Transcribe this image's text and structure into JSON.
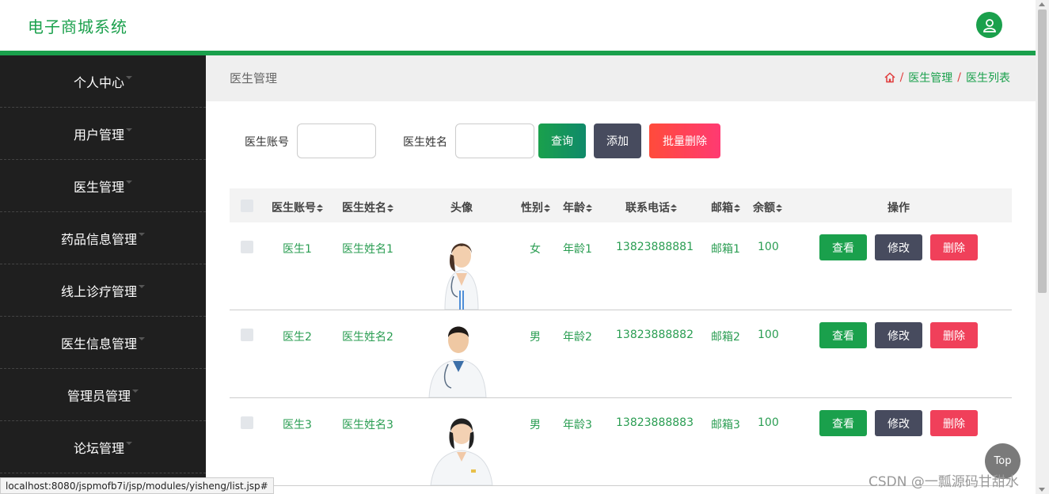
{
  "header": {
    "brand": "电子商城系统",
    "avatar_icon": "user-icon"
  },
  "sidebar": {
    "items": [
      {
        "label": "个人中心"
      },
      {
        "label": "用户管理"
      },
      {
        "label": "医生管理"
      },
      {
        "label": "药品信息管理"
      },
      {
        "label": "线上诊疗管理"
      },
      {
        "label": "医生信息管理"
      },
      {
        "label": "管理员管理"
      },
      {
        "label": "论坛管理"
      }
    ]
  },
  "page": {
    "title": "医生管理",
    "breadcrumb": [
      "医生管理",
      "医生列表"
    ],
    "breadcrumb_sep": "/"
  },
  "search": {
    "account_label": "医生账号",
    "name_label": "医生姓名",
    "account_value": "",
    "name_value": "",
    "query_button": "查询",
    "add_button": "添加",
    "batch_delete_button": "批量删除"
  },
  "table": {
    "headers": {
      "account": "医生账号",
      "name": "医生姓名",
      "photo": "头像",
      "gender": "性别",
      "age": "年龄",
      "phone": "联系电话",
      "email": "邮箱",
      "balance": "余额",
      "actions": "操作"
    },
    "rows": [
      {
        "account": "医生1",
        "name": "医生姓名1",
        "gender": "女",
        "age": "年龄1",
        "phone": "13823888881",
        "email": "邮箱1",
        "balance": "100"
      },
      {
        "account": "医生2",
        "name": "医生姓名2",
        "gender": "男",
        "age": "年龄2",
        "phone": "13823888882",
        "email": "邮箱2",
        "balance": "100"
      },
      {
        "account": "医生3",
        "name": "医生姓名3",
        "gender": "男",
        "age": "年龄3",
        "phone": "13823888883",
        "email": "邮箱3",
        "balance": "100"
      }
    ],
    "view_button": "查看",
    "edit_button": "修改",
    "delete_button": "删除"
  },
  "status_url": "localhost:8080/jspmofb7i/jsp/modules/yisheng/list.jsp#",
  "top_button": "Top",
  "watermark": "CSDN @一瓢源码甘甜水",
  "colors": {
    "accent": "#1aa04c",
    "sidebar_bg": "#1f1f1f",
    "view_btn": "#1aa04c",
    "edit_btn": "#474b5e",
    "delete_btn": "#f0405a",
    "batch_delete_from": "#ff4b3b",
    "batch_delete_to": "#ff3a72"
  }
}
